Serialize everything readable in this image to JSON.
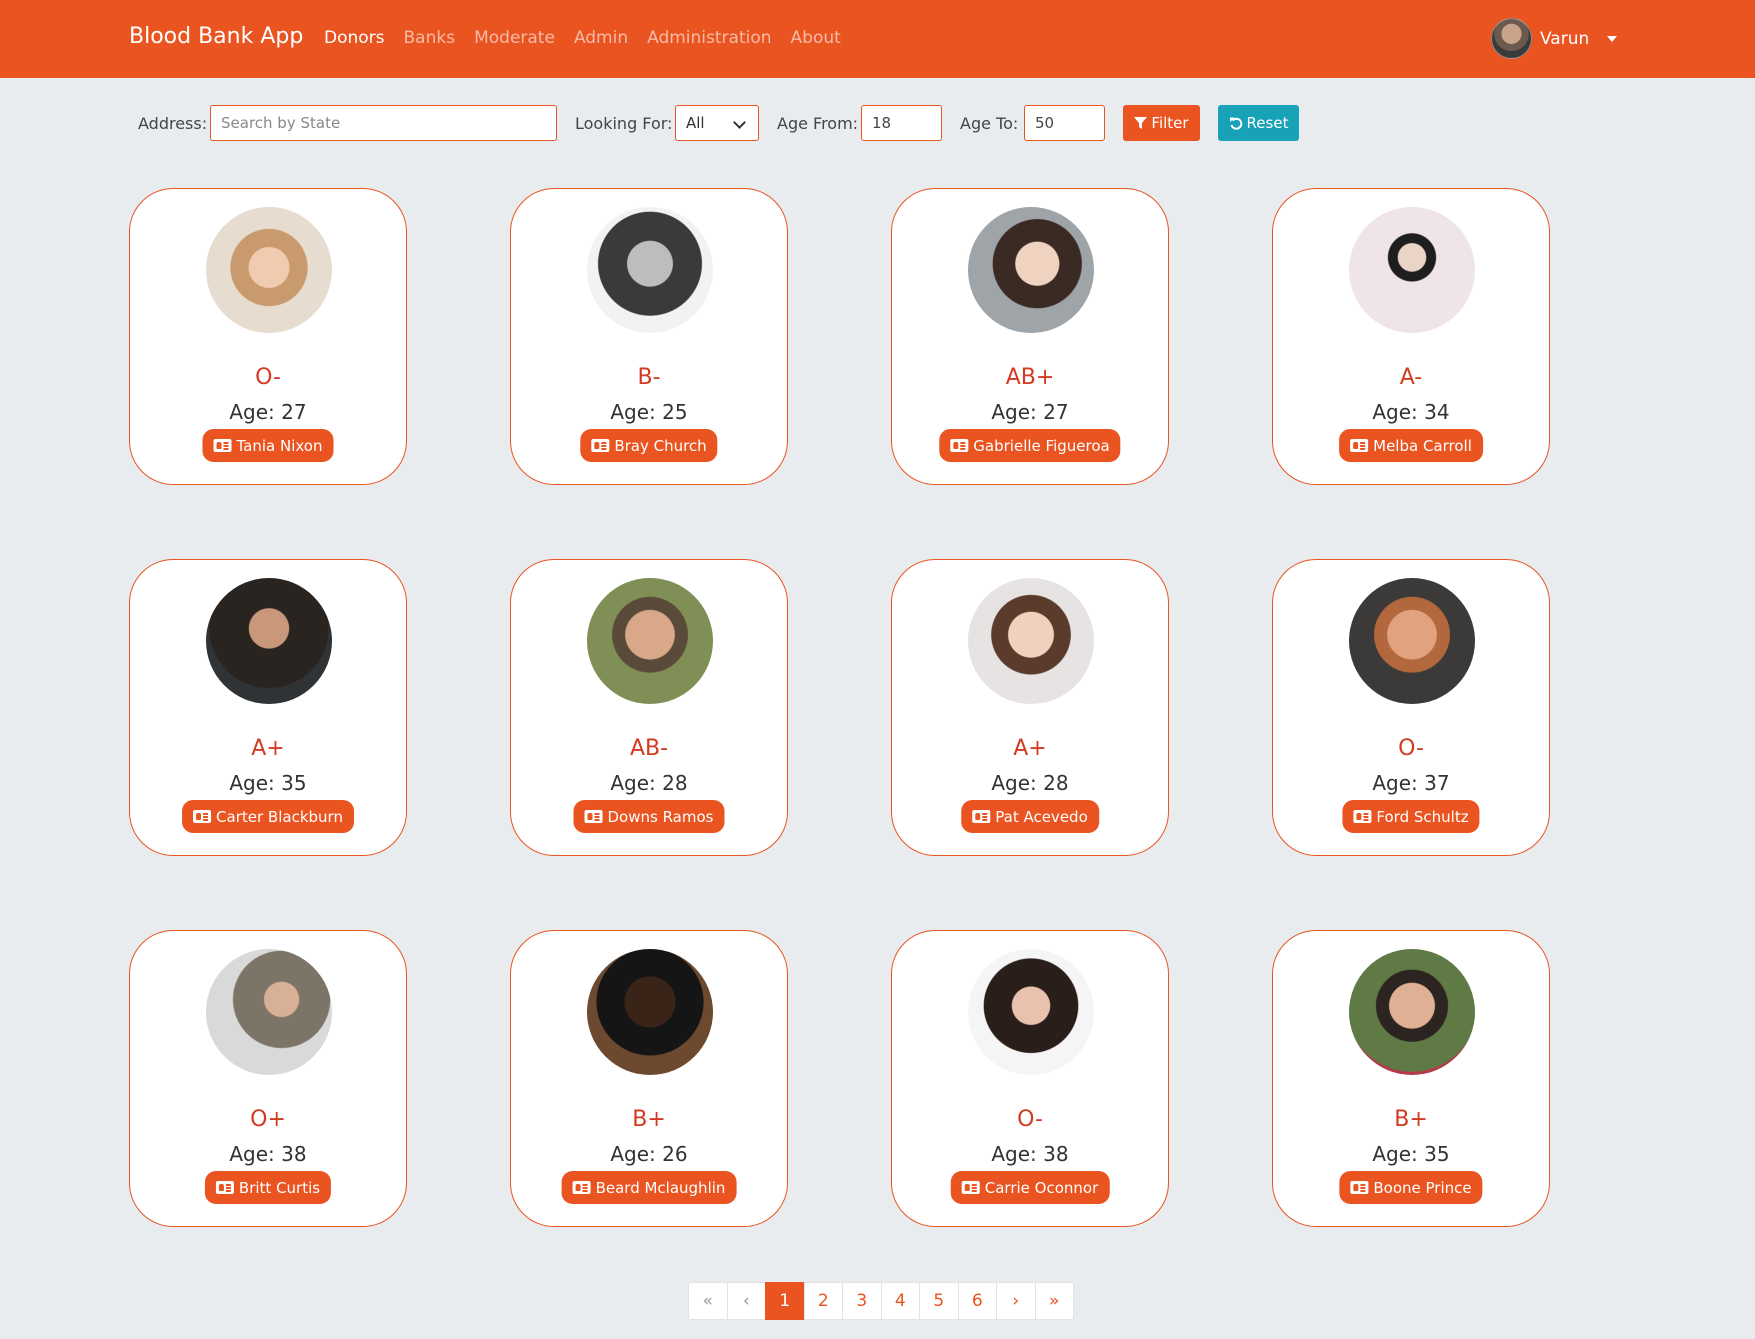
{
  "app": {
    "title": "Blood Bank App"
  },
  "nav": {
    "items": [
      {
        "label": "Donors",
        "active": true
      },
      {
        "label": "Banks"
      },
      {
        "label": "Moderate"
      },
      {
        "label": "Admin"
      },
      {
        "label": "Administration"
      },
      {
        "label": "About"
      }
    ]
  },
  "user": {
    "name": "Varun"
  },
  "filters": {
    "address_label": "Address:",
    "address_placeholder": "Search by State",
    "looking_for_label": "Looking For:",
    "looking_for_value": "All",
    "age_from_label": "Age From:",
    "age_from_value": "18",
    "age_to_label": "Age To:",
    "age_to_value": "50",
    "filter_label": "Filter",
    "reset_label": "Reset"
  },
  "donors": [
    {
      "blood": "O-",
      "age": "Age: 27",
      "name": "Tania Nixon"
    },
    {
      "blood": "B-",
      "age": "Age: 25",
      "name": "Bray Church"
    },
    {
      "blood": "AB+",
      "age": "Age: 27",
      "name": "Gabrielle Figueroa"
    },
    {
      "blood": "A-",
      "age": "Age: 34",
      "name": "Melba Carroll"
    },
    {
      "blood": "A+",
      "age": "Age: 35",
      "name": "Carter Blackburn"
    },
    {
      "blood": "AB-",
      "age": "Age: 28",
      "name": "Downs Ramos"
    },
    {
      "blood": "A+",
      "age": "Age: 28",
      "name": "Pat Acevedo"
    },
    {
      "blood": "O-",
      "age": "Age: 37",
      "name": "Ford Schultz"
    },
    {
      "blood": "O+",
      "age": "Age: 38",
      "name": "Britt Curtis"
    },
    {
      "blood": "B+",
      "age": "Age: 26",
      "name": "Beard Mclaughlin"
    },
    {
      "blood": "O-",
      "age": "Age: 38",
      "name": "Carrie Oconnor"
    },
    {
      "blood": "B+",
      "age": "Age: 35",
      "name": "Boone Prince"
    }
  ],
  "pagination": {
    "first": "«",
    "prev": "‹",
    "pages": [
      "1",
      "2",
      "3",
      "4",
      "5",
      "6"
    ],
    "active_page": "1",
    "next": "›",
    "last": "»"
  },
  "colors": {
    "primary": "#e95420",
    "info": "#17a2b8",
    "background": "#e9ecef",
    "blood_text": "#d23a22"
  }
}
